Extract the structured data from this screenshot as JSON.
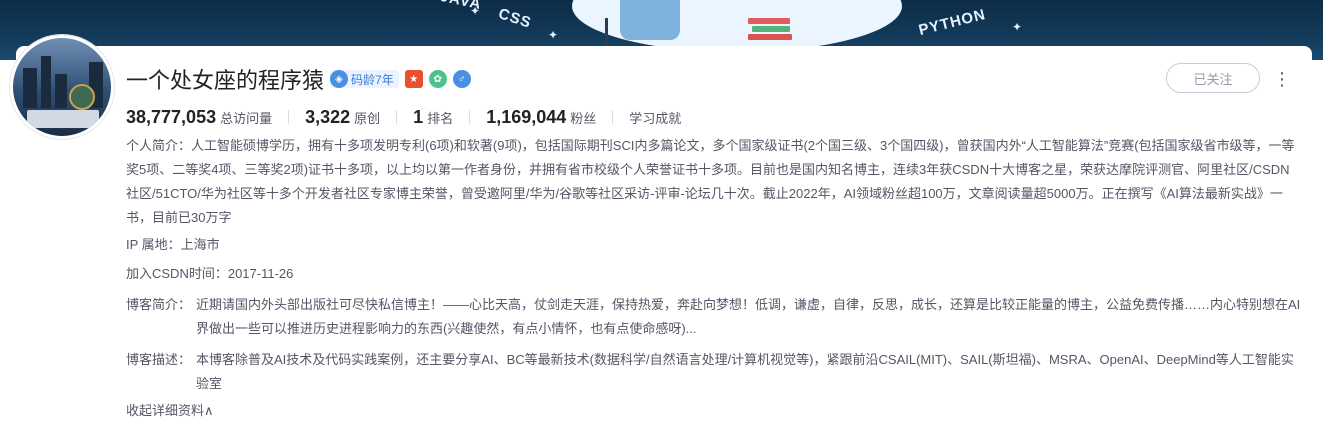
{
  "banner": {
    "words": [
      "JAVA",
      "CSS",
      "PYTHON"
    ]
  },
  "profile": {
    "name": "一个处女座的程序猿",
    "code_age_badge": "码龄7年",
    "follow_button": "已关注",
    "more_icon": "⋮"
  },
  "stats": [
    {
      "value": "38,777,053",
      "label": "总访问量"
    },
    {
      "value": "3,322",
      "label": "原创"
    },
    {
      "value": "1",
      "label": "排名"
    },
    {
      "value": "1,169,044",
      "label": "粉丝"
    }
  ],
  "achievements_label": "学习成就",
  "intro": "个人简介：人工智能硕博学历，拥有十多项发明专利(6项)和软著(9项)，包括国际期刊SCI内多篇论文，多个国家级证书(2个国三级、3个国四级)，曾获国内外“人工智能算法”竞赛(包括国家级省市级等，一等奖5项、二等奖4项、三等奖2项)证书十多项，以上均以第一作者身份，并拥有省市校级个人荣誉证书十多项。目前也是国内知名博主，连续3年获CSDN十大博客之星，荣获达摩院评测官、阿里社区/CSDN社区/51CTO/华为社区等十多个开发者社区专家博主荣誉，曾受邀阿里/华为/谷歌等社区采访-评审-论坛几十次。截止2022年，AI领域粉丝超100万，文章阅读量超5000万。正在撰写《AI算法最新实战》一书，目前已30万字",
  "ip_location": "IP 属地：上海市",
  "join_date": "加入CSDN时间：2017-11-26",
  "blog_intro": {
    "label": "博客简介：",
    "text": "近期请国内外头部出版社可尽快私信博主！——心比天高，仗剑走天涯，保持热爱，奔赴向梦想！低调，谦虚，自律，反思，成长，还算是比较正能量的博主，公益免费传播……内心特别想在AI界做出一些可以推进历史进程影响力的东西(兴趣使然，有点小情怀，也有点使命感呀)..."
  },
  "blog_desc": {
    "label": "博客描述：",
    "text": "本博客除普及AI技术及代码实践案例，还主要分享AI、BC等最新技术(数据科学/自然语言处理/计算机视觉等)，紧跟前沿CSAIL(MIT)、SAIL(斯坦福)、MSRA、OpenAI、DeepMind等人工智能实验室"
  },
  "collapse_link": "收起详细资料∧"
}
